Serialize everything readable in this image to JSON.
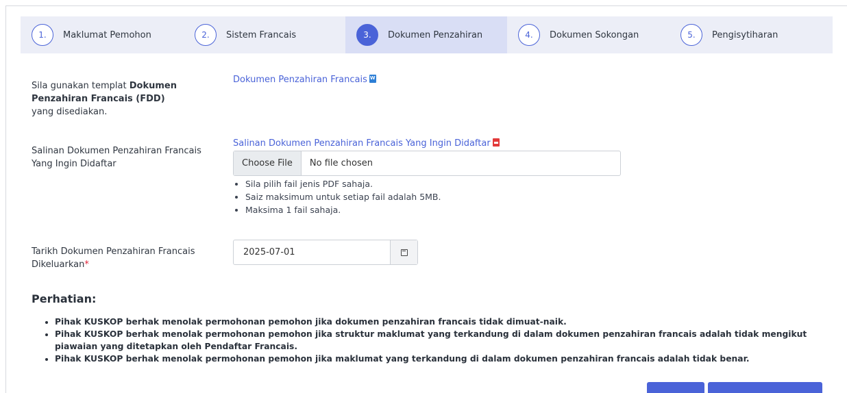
{
  "steps": [
    {
      "num": "1.",
      "label": "Maklumat Pemohon"
    },
    {
      "num": "2.",
      "label": "Sistem Francais"
    },
    {
      "num": "3.",
      "label": "Dokumen Penzahiran"
    },
    {
      "num": "4.",
      "label": "Dokumen Sokongan"
    },
    {
      "num": "5.",
      "label": "Pengisytiharan"
    }
  ],
  "template_row": {
    "label_pre": "Sila gunakan templat ",
    "label_bold": "Dokumen Penzahiran Francais (FDD)",
    "label_post": " yang disediakan.",
    "link": "Dokumen Penzahiran Francais",
    "link_icon": "word-file-icon"
  },
  "upload_row": {
    "label": "Salinan Dokumen Penzahiran Francais Yang Ingin Didaftar",
    "link": "Salinan Dokumen Penzahiran Francais Yang Ingin Didaftar",
    "link_icon": "pdf-file-icon",
    "choose_button": "Choose File",
    "file_status": "No file chosen",
    "hints": [
      "Sila pilih fail jenis PDF sahaja.",
      "Saiz maksimum untuk setiap fail adalah 5MB.",
      "Maksima 1 fail sahaja."
    ]
  },
  "date_row": {
    "label": "Tarikh Dokumen Penzahiran Francais Dikeluarkan",
    "required_mark": "*",
    "value": "2025-07-01",
    "icon": "calendar-icon"
  },
  "notice": {
    "title": "Perhatian:",
    "items": [
      "Pihak KUSKOP berhak menolak permohonan pemohon jika dokumen penzahiran francais tidak dimuat-naik.",
      "Pihak KUSKOP berhak menolak permohonan pemohon jika struktur maklumat yang terkandung di dalam dokumen penzahiran francais adalah tidak mengikut piawaian yang ditetapkan oleh Pendaftar Francais.",
      "Pihak KUSKOP berhak menolak permohonan pemohon jika maklumat yang terkandung di dalam dokumen penzahiran francais adalah tidak benar."
    ]
  },
  "colors": {
    "accent": "#4a63d8",
    "required": "#e0243a",
    "stepper_bg": "#eceef7",
    "active_step_bg": "#d9def5"
  }
}
